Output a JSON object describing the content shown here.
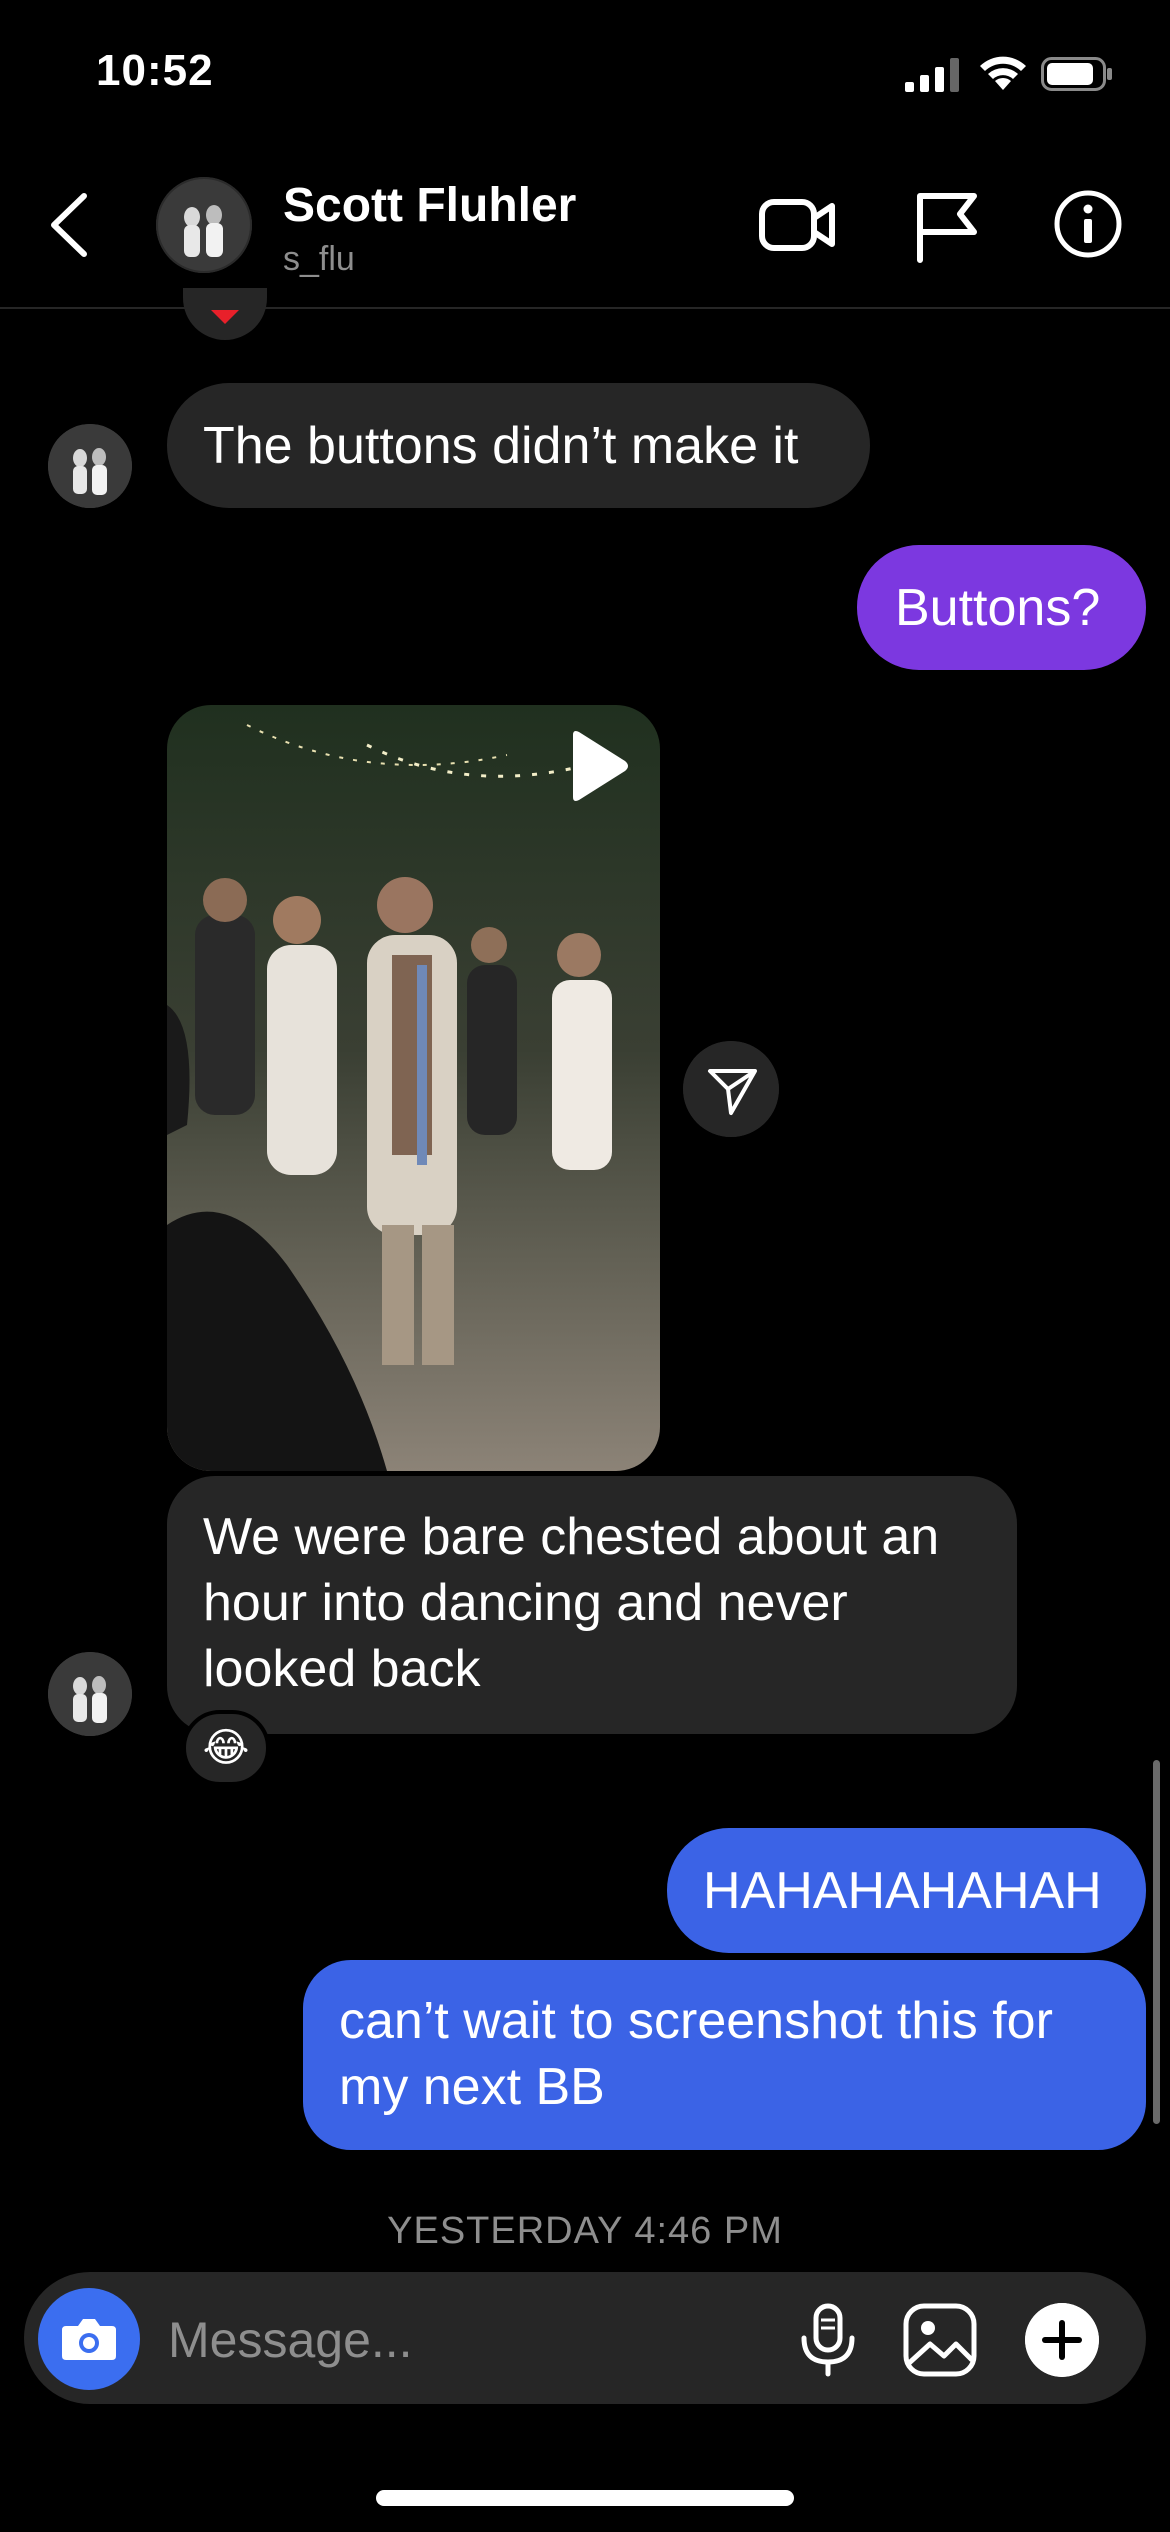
{
  "status_bar": {
    "time": "10:52"
  },
  "header": {
    "name": "Scott Fluhler",
    "username": "s_flu"
  },
  "messages": [
    {
      "side": "in",
      "text": "The buttons didn’t make it"
    },
    {
      "side": "out",
      "text": "Buttons?"
    },
    {
      "side": "in",
      "type": "video"
    },
    {
      "side": "in",
      "text": "We were bare chested about an hour into dancing and never looked back",
      "reaction": "😂"
    },
    {
      "side": "out",
      "text": "HAHAHAHAHAH"
    },
    {
      "side": "out",
      "text": "can’t wait to screenshot this for my next BB"
    }
  ],
  "timestamp": "YESTERDAY 4:46 PM",
  "composer": {
    "placeholder": "Message..."
  },
  "icons": [
    "back-icon",
    "video-call-icon",
    "flag-icon",
    "info-icon",
    "play-icon",
    "send-icon",
    "camera-icon",
    "microphone-icon",
    "gallery-icon",
    "plus-icon"
  ],
  "colors": {
    "outgoing_purple": "#7c38e0",
    "outgoing_blue": "#3b63e6",
    "incoming": "#262626",
    "camera": "#3b6ef0"
  }
}
